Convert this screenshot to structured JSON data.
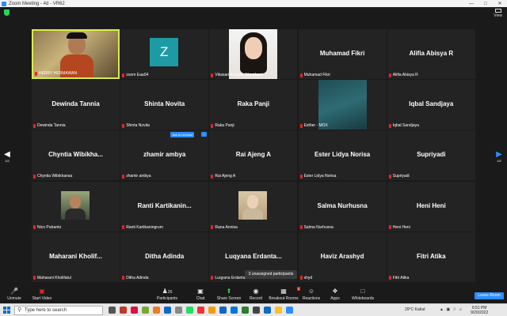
{
  "window": {
    "title": "Zoom Meeting - 4d - VR62",
    "min": "—",
    "max": "□",
    "close": "✕"
  },
  "topbar": {
    "view_label": "View"
  },
  "participants_tiles": [
    {
      "name": "HERRY HERMAWAN",
      "label": "HERRY HERMAWAN",
      "type": "video",
      "active": true
    },
    {
      "name": "zoom Eaa04",
      "label": "zoom Eaa04",
      "type": "avatar",
      "initial": "Z"
    },
    {
      "name": "Vikasari Anggun Warsthani",
      "label": "Vikasari Anggun Warsthani",
      "type": "video"
    },
    {
      "name": "Muhamad Fikri",
      "label": "Muhamad Fikri",
      "type": "name"
    },
    {
      "name": "Alifia Abisya R",
      "label": "Alifia Abisya R",
      "type": "name"
    },
    {
      "name": "Dewinda Tannia",
      "label": "Dewinda Tannia",
      "type": "name"
    },
    {
      "name": "Shinta Novita",
      "label": "Shinta Novita",
      "type": "name"
    },
    {
      "name": "Raka Panji",
      "label": "Raka Panji",
      "type": "name"
    },
    {
      "name": "Esther - MOX",
      "label": "Esther - MOX",
      "type": "video"
    },
    {
      "name": "Iqbal Sandjaya",
      "label": "Iqbal Sandjaya",
      "type": "name"
    },
    {
      "name": "Chyntia  Wibikha...",
      "label": "Chyntia Wibikhansa",
      "type": "name"
    },
    {
      "name": "zhamir ambya",
      "label": "zhamir ambya",
      "type": "name"
    },
    {
      "name": "Rai Ajeng A",
      "label": "Rai Ajeng A",
      "type": "name"
    },
    {
      "name": "Ester Lidya Norisa",
      "label": "Ester Lidya Norisa",
      "type": "name"
    },
    {
      "name": "Supriyadi",
      "label": "Supriyadi",
      "type": "name"
    },
    {
      "name": "Nico Putranto",
      "label": "Nico Putranto",
      "type": "photo"
    },
    {
      "name": "Ranti  Kartikanin...",
      "label": "Ranti Kartikaningrum",
      "type": "name"
    },
    {
      "name": "Rana Annisa",
      "label": "Rana Annisa",
      "type": "photo"
    },
    {
      "name": "Salma Nurhusna",
      "label": "Salma Nurhusna",
      "type": "name"
    },
    {
      "name": "Heni Heni",
      "label": "Heni Heni",
      "type": "name"
    },
    {
      "name": "Maharani  Kholif...",
      "label": "Maharani Kholifatul",
      "type": "name"
    },
    {
      "name": "Ditha Adinda",
      "label": "Ditha Adinda",
      "type": "name"
    },
    {
      "name": "Luqyana  Erdanta...",
      "label": "Luqyana Erdanta",
      "type": "name"
    },
    {
      "name": "Haviz Arashyd",
      "label": "shyd",
      "type": "name"
    },
    {
      "name": "Fitri Atika",
      "label": "Fitri Atika",
      "type": "name"
    }
  ],
  "badges": {
    "add_to_unmute": "Ask to Unmute",
    "more": "…"
  },
  "nav": {
    "left_page": "1/2",
    "right_page": "1/2"
  },
  "unassigned_label": "3 unassigned participants",
  "toolbar": {
    "unmute": "Unmute",
    "start_video": "Start Video",
    "participants": "Participants",
    "participants_count": "26",
    "chat": "Chat",
    "share_screen": "Share Screen",
    "record": "Record",
    "breakout_rooms": "Breakout Rooms",
    "breakout_badge": "4",
    "reactions": "Reactions",
    "apps": "Apps",
    "whiteboards": "Whiteboards",
    "leave": "Leave Room"
  },
  "taskbar": {
    "search_placeholder": "Type here to search",
    "weather": "29°C  Kabut",
    "time": "6:51 PM",
    "date": "9/20/2022"
  },
  "colors": {
    "active_speaker": "#d9ee44",
    "accent": "#2d8cff",
    "mic_muted": "#e02828",
    "share_green": "#23d959"
  }
}
